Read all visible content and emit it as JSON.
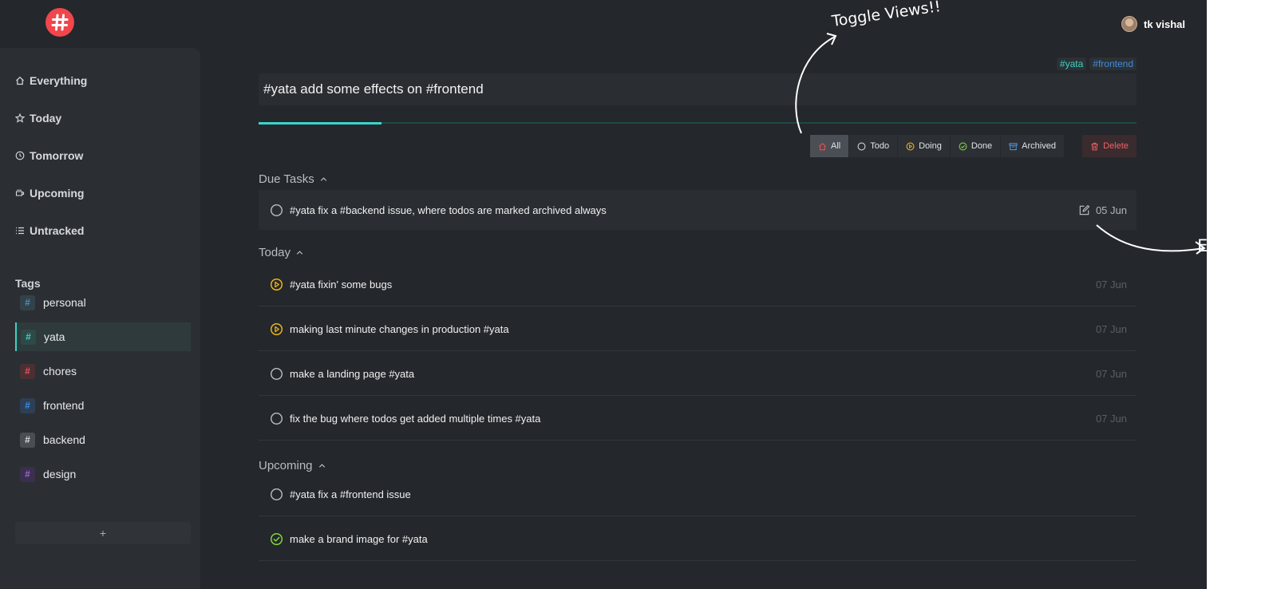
{
  "app": {
    "logo_icon": "hash-logo-icon",
    "brand_color": "#f0464c",
    "accent_color": "#39d6cb"
  },
  "sidebar": {
    "nav": [
      {
        "label": "Everything",
        "icon": "home-icon"
      },
      {
        "label": "Today",
        "icon": "star-icon"
      },
      {
        "label": "Tomorrow",
        "icon": "clock-icon"
      },
      {
        "label": "Upcoming",
        "icon": "coffee-icon"
      },
      {
        "label": "Untracked",
        "icon": "list-icon"
      }
    ],
    "tags_heading": "Tags",
    "tags": [
      {
        "label": "personal",
        "color": "#4d8fb8",
        "bg": "#33414b"
      },
      {
        "label": "yata",
        "color": "#3fd1c4",
        "bg": "#2c4a48",
        "active": true
      },
      {
        "label": "chores",
        "color": "#e0545a",
        "bg": "#4a2f33"
      },
      {
        "label": "frontend",
        "color": "#3f8de0",
        "bg": "#2d3f55"
      },
      {
        "label": "backend",
        "color": "#d9dadc",
        "bg": "#4a4d52"
      },
      {
        "label": "design",
        "color": "#9a63d8",
        "bg": "#3a2f4c"
      }
    ],
    "add_tag_label": "+"
  },
  "header": {
    "user_name": "tk vishal"
  },
  "composer": {
    "value": "#yata add some effects on #frontend",
    "chips": [
      {
        "label": "#yata",
        "color": "#3fd1c4"
      },
      {
        "label": "#frontend",
        "color": "#3f8de0"
      }
    ],
    "progress": 0.14
  },
  "toggles": {
    "items": [
      {
        "label": "All",
        "icon": "home-icon",
        "active": true
      },
      {
        "label": "Todo",
        "icon": "circle-icon"
      },
      {
        "label": "Doing",
        "icon": "play-circle-icon"
      },
      {
        "label": "Done",
        "icon": "check-circle-icon"
      },
      {
        "label": "Archived",
        "icon": "archive-icon"
      }
    ],
    "delete_label": "Delete"
  },
  "sections": {
    "due": {
      "heading": "Due Tasks",
      "tasks": [
        {
          "text": "#yata fix a #backend issue, where todos are marked archived always",
          "date": "05 Jun",
          "status": "todo"
        }
      ]
    },
    "today": {
      "heading": "Today",
      "tasks": [
        {
          "text": "#yata fixin' some bugs",
          "date": "07 Jun",
          "status": "doing"
        },
        {
          "text": "making last minute changes in production #yata",
          "date": "07 Jun",
          "status": "doing"
        },
        {
          "text": "make a landing page #yata",
          "date": "07 Jun",
          "status": "todo"
        },
        {
          "text": "fix the bug where todos get added multiple times #yata",
          "date": "07 Jun",
          "status": "todo"
        }
      ]
    },
    "upcoming": {
      "heading": "Upcoming",
      "tasks": [
        {
          "text": "#yata fix a #frontend issue",
          "date": "",
          "status": "todo"
        },
        {
          "text": "make a brand image for #yata",
          "date": "",
          "status": "done"
        }
      ]
    }
  },
  "annotations": {
    "toggle_views": "Toggle Views!!",
    "edit_partial": "E"
  }
}
